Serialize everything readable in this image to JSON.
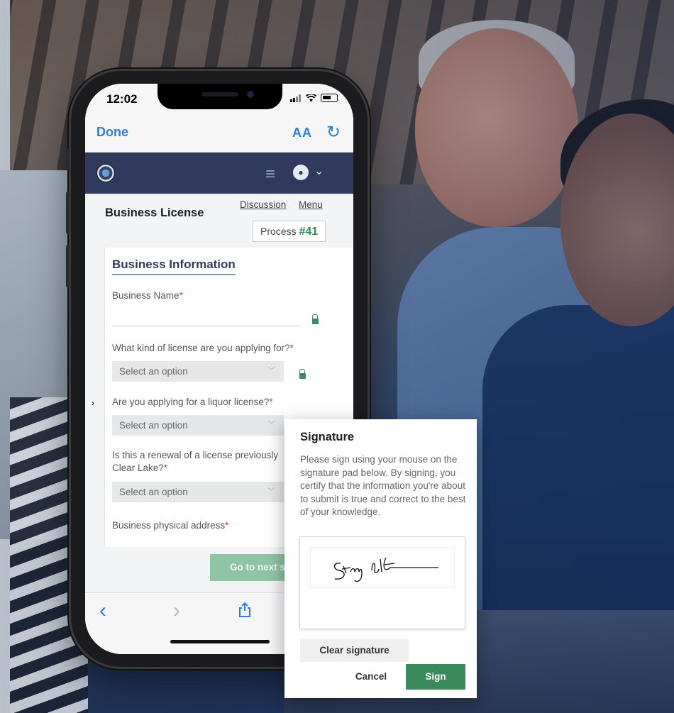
{
  "status_bar": {
    "time": "12:02"
  },
  "browser": {
    "done_label": "Done",
    "text_size_label": "AA"
  },
  "page": {
    "title": "Business License",
    "links": [
      "Discussion",
      "Menu"
    ],
    "process_label": "Process",
    "process_number": "#41"
  },
  "form": {
    "section_title": "Business Information",
    "fields": [
      {
        "label": "Business Name",
        "required": "*"
      },
      {
        "label": "What kind of license are you applying for?",
        "required": "*",
        "placeholder": "Select an option"
      },
      {
        "label": "Are you applying for a liquor license?",
        "required": "*",
        "placeholder": "Select an option"
      },
      {
        "label": "Is this a renewal of a license previously",
        "label_line2": "Clear Lake?",
        "required": "*",
        "placeholder": "Select an option"
      },
      {
        "label": "Business physical address",
        "required": "*"
      }
    ],
    "next_button": "Go to next s"
  },
  "signature_dialog": {
    "title": "Signature",
    "description": "Please sign using your mouse on the signature pad below. By signing, you certify that the information you're about to submit is true and correct to the best of your knowledge.",
    "clear_label": "Clear signature",
    "cancel_label": "Cancel",
    "sign_label": "Sign"
  },
  "colors": {
    "navbar": "#2f3a5c",
    "accent_green": "#3b8a5a",
    "link_blue": "#2b7de0",
    "required_red": "#d23b3b"
  },
  "icons": {
    "reload": "reload-icon",
    "hamburger": "hamburger-menu-icon",
    "user": "user-avatar-icon",
    "back": "chevron-left-icon",
    "forward": "chevron-right-icon",
    "share": "share-icon",
    "lock": "lock-icon"
  }
}
